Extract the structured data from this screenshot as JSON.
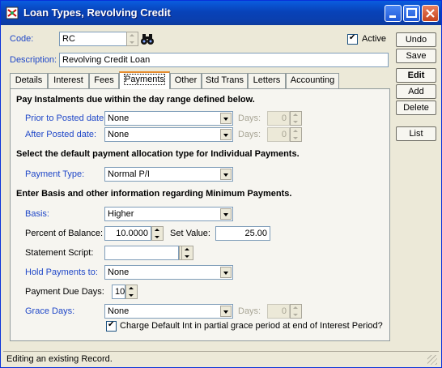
{
  "window": {
    "title": "Loan Types, Revolving Credit"
  },
  "header": {
    "code_label": "Code:",
    "code_value": "RC",
    "active_label": "Active",
    "description_label": "Description:",
    "description_value": "Revolving Credit Loan"
  },
  "side_buttons": {
    "undo": "Undo",
    "save": "Save",
    "edit": "Edit",
    "add": "Add",
    "delete": "Delete",
    "list": "List"
  },
  "tabs": [
    "Details",
    "Interest",
    "Fees",
    "Payments",
    "Other",
    "Std Trans",
    "Letters",
    "Accounting"
  ],
  "active_tab": "Payments",
  "payments": {
    "section1": "Pay Instalments due within the day range defined below.",
    "prior_label": "Prior to Posted date:",
    "prior_value": "None",
    "prior_days_label": "Days:",
    "prior_days_value": "0",
    "after_label": "After Posted date:",
    "after_value": "None",
    "after_days_label": "Days:",
    "after_days_value": "0",
    "section2": "Select the default payment allocation type for Individual Payments.",
    "payment_type_label": "Payment Type:",
    "payment_type_value": "Normal P/I",
    "section3": "Enter Basis and other information regarding Minimum Payments.",
    "basis_label": "Basis:",
    "basis_value": "Higher",
    "percent_label": "Percent of Balance:",
    "percent_value": "10.0000",
    "set_value_label": "Set Value:",
    "set_value_value": "25.00",
    "statement_script_label": "Statement Script:",
    "statement_script_value": "",
    "hold_label": "Hold Payments to:",
    "hold_value": "None",
    "due_days_label": "Payment Due Days:",
    "due_days_value": "10",
    "grace_label": "Grace Days:",
    "grace_value": "None",
    "grace_days_label": "Days:",
    "grace_days_value": "0",
    "charge_default_label": "Charge Default Int in partial grace period at end of Interest Period?"
  },
  "status": {
    "text": "Editing an existing Record."
  },
  "colors": {
    "title_bar": "#0842b8",
    "link_label": "#1f47c8",
    "active_tab_accent": "#e68b2c"
  }
}
